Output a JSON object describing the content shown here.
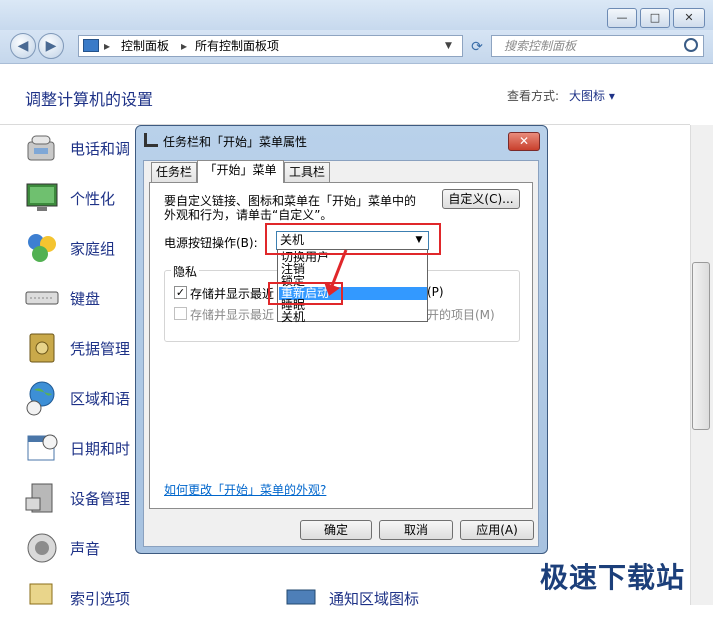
{
  "window": {
    "minimize": "—",
    "maximize": "□",
    "close": "✕"
  },
  "nav": {
    "back": "◀",
    "forward": "▶",
    "breadcrumb": [
      "控制面板",
      "所有控制面板项"
    ],
    "search_placeholder": "搜索控制面板"
  },
  "content": {
    "heading": "调整计算机的设置",
    "view_by_label": "查看方式:",
    "view_by_value": "大图标 ▾",
    "items": [
      {
        "label": "电话和调"
      },
      {
        "label": "个性化"
      },
      {
        "label": "家庭组"
      },
      {
        "label": "键盘"
      },
      {
        "label": "凭据管理"
      },
      {
        "label": "区域和语"
      },
      {
        "label": "日期和时"
      },
      {
        "label": "设备管理"
      },
      {
        "label": "声音"
      },
      {
        "label": "索引选项"
      }
    ],
    "item_right_partial": "通知区域图标"
  },
  "dialog": {
    "title": "任务栏和「开始」菜单属性",
    "close": "✕",
    "tabs": [
      {
        "label": "任务栏"
      },
      {
        "label": "「开始」菜单"
      },
      {
        "label": "工具栏"
      }
    ],
    "description_line1": "要自定义链接、图标和菜单在「开始」菜单中的",
    "description_line2": "外观和行为，请单击“自定义”。",
    "customize_button": "自定义(C)...",
    "power_label": "电源按钮操作(B):",
    "power_value": "关机",
    "dropdown_options": [
      {
        "label": "切换用户",
        "selected": false
      },
      {
        "label": "注销",
        "selected": false
      },
      {
        "label": "锁定",
        "selected": false
      },
      {
        "label": "重新启动",
        "selected": true
      },
      {
        "label": "睡眠",
        "selected": false
      },
      {
        "label": "关机",
        "selected": false
      }
    ],
    "privacy_group": "隐私",
    "privacy_opt1_left": "存储并显示最近",
    "privacy_opt1_right": "(P)",
    "privacy_opt1_checked": true,
    "privacy_opt2_left": "存储并显示最近",
    "privacy_opt2_right": "开的项目(M)",
    "privacy_opt2_checked": false,
    "link": "如何更改「开始」菜单的外观?",
    "ok": "确定",
    "cancel": "取消",
    "apply": "应用(A)"
  },
  "watermark": "极速下载站"
}
